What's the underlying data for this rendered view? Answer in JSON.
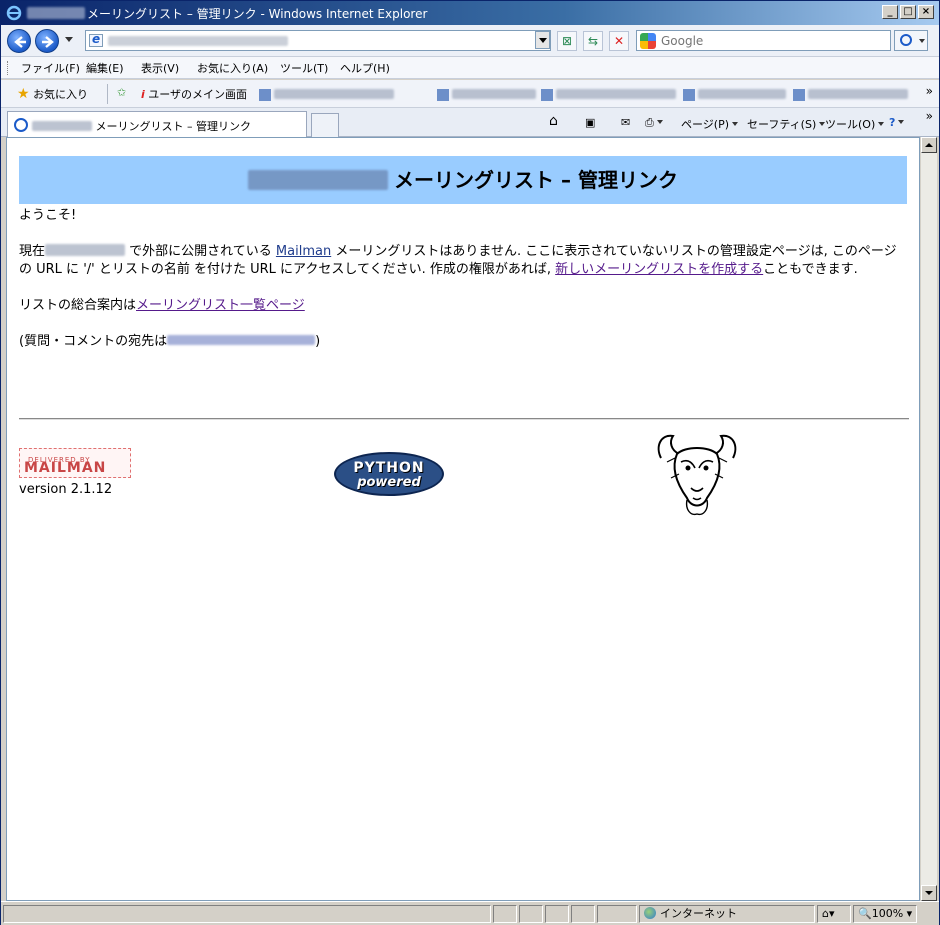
{
  "window": {
    "title": "メーリングリスト – 管理リンク - Windows Internet Explorer",
    "controls": {
      "minimize": "_",
      "maximize": "□",
      "close": "×"
    }
  },
  "addressbar": {
    "search_placeholder": "Google"
  },
  "menu": [
    "ファイル(F)",
    "編集(E)",
    "表示(V)",
    "お気に入り(A)",
    "ツール(T)",
    "ヘルプ(H)"
  ],
  "favorites": {
    "favorites_label": "お気に入り",
    "main_screen_label": "ユーザのメイン画面"
  },
  "tab": {
    "title": "メーリングリスト – 管理リンク"
  },
  "command_bar": {
    "page_label": "ページ(P)",
    "safety_label": "セーフティ(S)",
    "tools_label": "ツール(O)"
  },
  "page": {
    "heading": "メーリングリスト – 管理リンク",
    "welcome": "ようこそ!",
    "intro_prefix": "現在",
    "intro_middle": "で外部に公開されている",
    "mailman_link": "Mailman",
    "intro_suffix": "メーリングリストはありません. ここに表示されていないリストの管理設定ページは, このページの URL に '/' とリストの名前 を付けた URL にアクセスしてください. 作成の権限があれば,",
    "create_link": "新しいメーリングリストを作成する",
    "intro_end": "こともできます.",
    "overview_prefix": "リストの総合案内は",
    "overview_link": "メーリングリスト一覧ページ",
    "contact_prefix": "(質問・コメントの宛先は",
    "contact_suffix": ")",
    "mailman_logo_top": "DELIVERED BY",
    "mailman_logo_main": "MAILMAN",
    "version": "version 2.1.12",
    "python_logo_top": "PYTHON",
    "python_logo_bottom": "powered"
  },
  "status": {
    "zone": "インターネット",
    "zoom": "100%"
  },
  "colors": {
    "banner": "#99ccff",
    "link": "#551a8b"
  }
}
